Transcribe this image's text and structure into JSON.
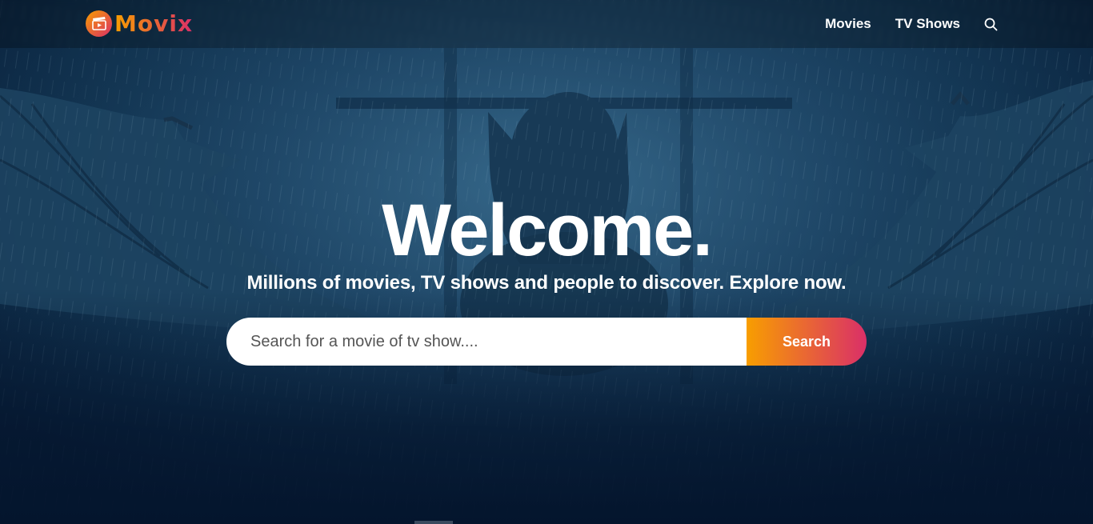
{
  "header": {
    "logo_text": "Movix",
    "nav": [
      "Movies",
      "TV Shows"
    ]
  },
  "hero": {
    "title": "Welcome.",
    "subtitle": "Millions of movies, TV shows and people to discover. Explore now."
  },
  "search": {
    "placeholder": "Search for a movie of tv show....",
    "value": "",
    "button_label": "Search"
  },
  "icons": {
    "logo": "film-clapper-icon",
    "nav_search": "search-icon"
  },
  "colors": {
    "accent_start": "#f89e00",
    "accent_end": "#da2f68",
    "background": "#04152d"
  }
}
